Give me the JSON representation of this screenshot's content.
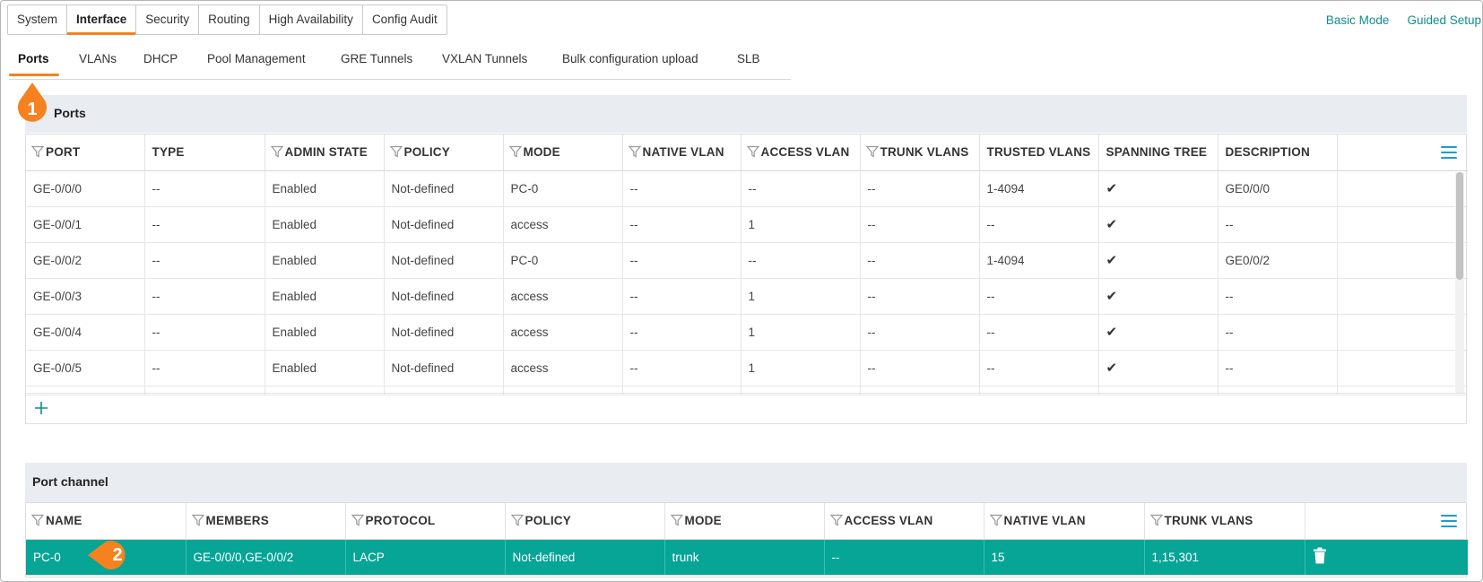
{
  "top_tabs": [
    "System",
    "Interface",
    "Security",
    "Routing",
    "High Availability",
    "Config Audit"
  ],
  "top_tab_active": "Interface",
  "right_links": {
    "basic_mode": "Basic Mode",
    "guided_setup": "Guided Setup"
  },
  "sub_tabs": [
    "Ports",
    "VLANs",
    "DHCP",
    "Pool Management",
    "GRE Tunnels",
    "VXLAN Tunnels",
    "Bulk configuration upload",
    "SLB"
  ],
  "sub_tab_active": "Ports",
  "callouts": {
    "first": "1",
    "second": "2"
  },
  "ports": {
    "title": "Ports",
    "columns": [
      "PORT",
      "TYPE",
      "ADMIN STATE",
      "POLICY",
      "MODE",
      "NATIVE VLAN",
      "ACCESS VLAN",
      "TRUNK VLANS",
      "TRUSTED VLANS",
      "SPANNING TREE",
      "DESCRIPTION"
    ],
    "rows": [
      [
        "GE-0/0/0",
        "--",
        "Enabled",
        "Not-defined",
        "PC-0",
        "--",
        "--",
        "--",
        "1-4094",
        "✔",
        "GE0/0/0"
      ],
      [
        "GE-0/0/1",
        "--",
        "Enabled",
        "Not-defined",
        "access",
        "--",
        "1",
        "--",
        "--",
        "✔",
        "--"
      ],
      [
        "GE-0/0/2",
        "--",
        "Enabled",
        "Not-defined",
        "PC-0",
        "--",
        "--",
        "--",
        "1-4094",
        "✔",
        "GE0/0/2"
      ],
      [
        "GE-0/0/3",
        "--",
        "Enabled",
        "Not-defined",
        "access",
        "--",
        "1",
        "--",
        "--",
        "✔",
        "--"
      ],
      [
        "GE-0/0/4",
        "--",
        "Enabled",
        "Not-defined",
        "access",
        "--",
        "1",
        "--",
        "--",
        "✔",
        "--"
      ],
      [
        "GE-0/0/5",
        "--",
        "Enabled",
        "Not-defined",
        "access",
        "--",
        "1",
        "--",
        "--",
        "✔",
        "--"
      ],
      [
        "",
        "",
        "",
        "",
        "",
        "",
        "",
        "",
        "",
        "",
        ""
      ]
    ]
  },
  "port_channel": {
    "title": "Port channel",
    "columns": [
      "NAME",
      "MEMBERS",
      "PROTOCOL",
      "POLICY",
      "MODE",
      "ACCESS VLAN",
      "NATIVE VLAN",
      "TRUNK VLANS"
    ],
    "rows": [
      [
        "PC-0",
        "GE-0/0/0,GE-0/0/2",
        "LACP",
        "Not-defined",
        "trunk",
        "--",
        "15",
        "1,15,301"
      ]
    ]
  },
  "colors": {
    "accent_orange": "#f5821f",
    "link_teal": "#0d8f8b",
    "selected_row": "#06a596",
    "header_bg": "#e9ecf1"
  }
}
